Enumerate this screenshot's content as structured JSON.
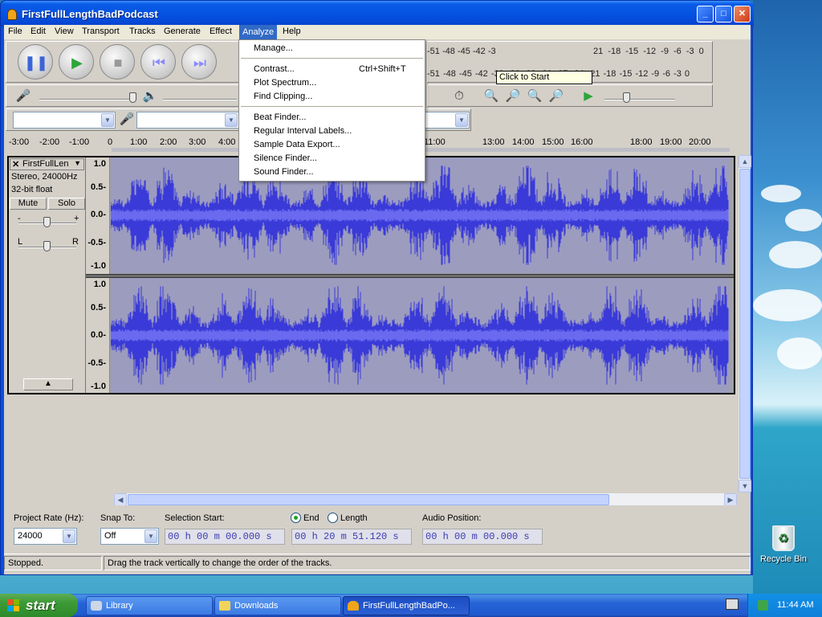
{
  "window": {
    "title": "FirstFullLengthBadPodcast"
  },
  "menubar": {
    "items": [
      "File",
      "Edit",
      "View",
      "Transport",
      "Tracks",
      "Generate",
      "Effect",
      "Analyze",
      "Help"
    ]
  },
  "analyze_menu": {
    "items": [
      {
        "label": "Manage..."
      },
      {
        "label": "Contrast...",
        "shortcut": "Ctrl+Shift+T"
      },
      {
        "label": "Plot Spectrum..."
      },
      {
        "label": "Find Clipping..."
      },
      {
        "label": "Beat Finder..."
      },
      {
        "label": "Regular Interval Labels..."
      },
      {
        "label": "Sample Data Export..."
      },
      {
        "label": "Silence Finder..."
      },
      {
        "label": "Sound Finder..."
      }
    ]
  },
  "meter": {
    "tooltip": "Click to Start Monitoring",
    "record_scale": "-51 -48 -45 -42 -3",
    "record_scale_right": "21 -18 -15 -12  -9  -6  -3  0",
    "play_scale": "-51 -48 -45 -42 -39 -36 -33 -30 -27 -24 -21 -18 -15 -12  -9  -6  -3  0"
  },
  "ruler": {
    "ticks": [
      "-3:00",
      "-2:00",
      "-1:00",
      "0",
      "1:00",
      "2:00",
      "3:00",
      "4:00",
      "11:00",
      "13:00",
      "14:00",
      "15:00",
      "16:00",
      "18:00",
      "19:00",
      "20:00"
    ]
  },
  "track": {
    "name": "FirstFullLen",
    "format": "Stereo, 24000Hz",
    "bitdepth": "32-bit float",
    "mute": "Mute",
    "solo": "Solo",
    "pan_left": "L",
    "pan_right": "R",
    "gain_minus": "-",
    "gain_plus": "+",
    "scale": [
      "1.0",
      "0.5-",
      "0.0-",
      "-0.5-",
      "-1.0"
    ]
  },
  "selection_bar": {
    "project_rate_label": "Project Rate (Hz):",
    "project_rate": "24000",
    "snap_to_label": "Snap To:",
    "snap_to": "Off",
    "selection_start_label": "Selection Start:",
    "selection_start": "00 h 00 m 00.000 s",
    "end_label": "End",
    "length_label": "Length",
    "end_value": "00 h 20 m 51.120 s",
    "audio_position_label": "Audio Position:",
    "audio_position": "00 h 00 m 00.000 s"
  },
  "status": {
    "state": "Stopped.",
    "message": "Drag the track vertically to change the order of the tracks."
  },
  "taskbar": {
    "start": "start",
    "tasks": [
      "Library",
      "Downloads",
      "FirstFullLengthBadPo..."
    ],
    "clock": "11:44 AM"
  },
  "desktop": {
    "recycle_bin": "Recycle Bin"
  },
  "colors": {
    "waveform": "#3a3ad8",
    "waveform_bg": "#9c9cbf",
    "menu_highlight": "#316ac5",
    "titlebar": "#0553e2"
  }
}
